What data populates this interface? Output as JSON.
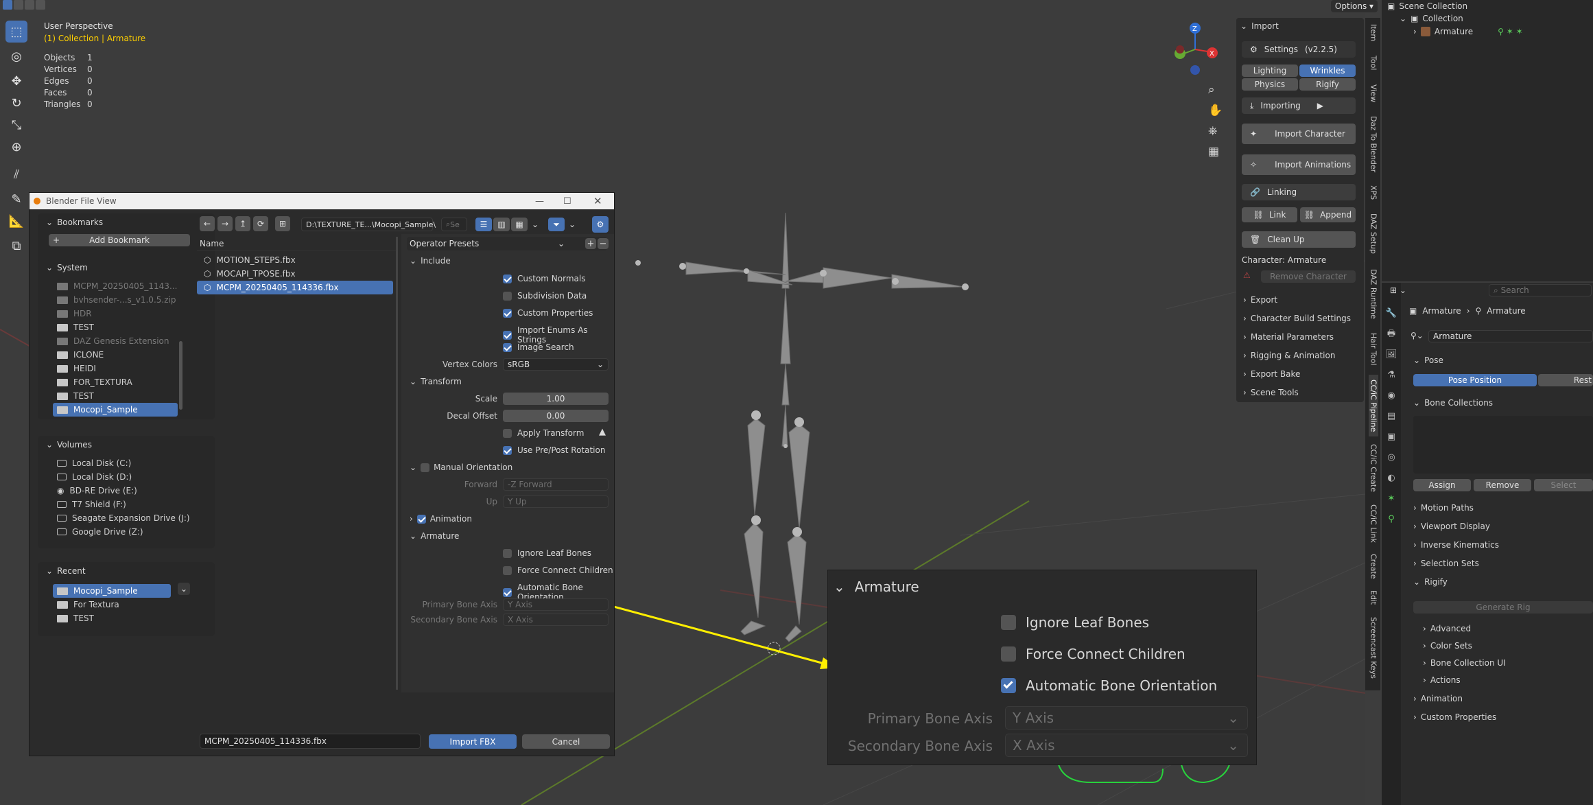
{
  "viewport": {
    "view_name": "User Perspective",
    "collection_label": "(1) Collection | Armature",
    "stats": [
      {
        "k": "Objects",
        "v": "1"
      },
      {
        "k": "Vertices",
        "v": "0"
      },
      {
        "k": "Edges",
        "v": "0"
      },
      {
        "k": "Faces",
        "v": "0"
      },
      {
        "k": "Triangles",
        "v": "0"
      }
    ],
    "options_label": "Options",
    "gizmo_z": "Z",
    "gizmo_x": "X"
  },
  "colors": {
    "accent": "#4772b3",
    "selection": "#4772b3",
    "arrow": "#ffef00",
    "label_yellow": "#ffd000"
  },
  "file_view": {
    "title": "Blender File View",
    "path": "D:\\TEXTURE_TE...\\Mocopi_Sample\\",
    "search_placeholder": "Se",
    "column_name": "Name",
    "files": [
      "MOTION_STEPS.fbx",
      "MOCAPI_TPOSE.fbx",
      "MCPM_20250405_114336.fbx"
    ],
    "filename_value": "MCPM_20250405_114336.fbx",
    "import_label": "Import FBX",
    "cancel_label": "Cancel",
    "bookmarks": {
      "title": "Bookmarks",
      "add_label": "Add Bookmark"
    },
    "system": {
      "title": "System",
      "items": [
        "MCPM_20250405_1143...",
        "bvhsender-...s_v1.0.5.zip",
        "HDR",
        "TEST",
        "DAZ Genesis Extension",
        "ICLONE",
        "HEIDI",
        "FOR_TEXTURA",
        "TEST",
        "Mocopi_Sample"
      ]
    },
    "volumes": {
      "title": "Volumes",
      "items": [
        "Local Disk (C:)",
        "Local Disk (D:)",
        "BD-RE Drive (E:)",
        "T7 Shield (F:)",
        "Seagate Expansion Drive (J:)",
        "Google Drive (Z:)"
      ]
    },
    "recent": {
      "title": "Recent",
      "items": [
        "Mocopi_Sample",
        "For Textura",
        "TEST"
      ]
    }
  },
  "operator": {
    "presets_label": "Operator Presets",
    "include": {
      "title": "Include",
      "custom_normals": "Custom Normals",
      "subdivision_data": "Subdivision Data",
      "custom_properties": "Custom Properties",
      "import_enums": "Import Enums As Strings",
      "image_search": "Image Search",
      "vertex_colors_label": "Vertex Colors",
      "vertex_colors_value": "sRGB"
    },
    "transform": {
      "title": "Transform",
      "scale_label": "Scale",
      "scale_value": "1.00",
      "decal_label": "Decal Offset",
      "decal_value": "0.00",
      "apply_transform": "Apply Transform",
      "use_pre_post": "Use Pre/Post Rotation"
    },
    "manual_orientation": {
      "title": "Manual Orientation",
      "forward_label": "Forward",
      "forward_value": "-Z Forward",
      "up_label": "Up",
      "up_value": "Y Up"
    },
    "animation": {
      "title": "Animation"
    },
    "armature": {
      "title": "Armature",
      "ignore_leaf": "Ignore Leaf Bones",
      "force_connect": "Force Connect Children",
      "auto_orient": "Automatic Bone Orientation",
      "primary_label": "Primary Bone Axis",
      "primary_value": "Y Axis",
      "secondary_label": "Secondary Bone Axis",
      "secondary_value": "X Axis"
    }
  },
  "zoom_panel": {
    "title": "Armature",
    "ignore_leaf": "Ignore Leaf Bones",
    "force_connect": "Force Connect Children",
    "auto_orient": "Automatic Bone Orientation",
    "primary_label": "Primary Bone Axis",
    "primary_value": "Y Axis",
    "secondary_label": "Secondary Bone Axis",
    "secondary_value": "X Axis"
  },
  "npanel": {
    "import_title": "Import",
    "settings_label": "Settings",
    "version": "(v2.2.5)",
    "tabs": [
      "Lighting",
      "Wrinkles",
      "Physics",
      "Rigify"
    ],
    "importing": "Importing",
    "import_character": "Import Character",
    "import_animations": "Import Animations",
    "linking": "Linking",
    "link": "Link",
    "append": "Append",
    "clean_up": "Clean Up",
    "character_label": "Character: Armature",
    "remove_character": "Remove Character",
    "sections": [
      "Export",
      "Character Build Settings",
      "Material Parameters",
      "Rigging & Animation",
      "Export Bake",
      "Scene Tools"
    ],
    "vertical_tabs": [
      "Item",
      "Tool",
      "View",
      "Daz To Blender",
      "XPS",
      "DAZ Setup",
      "DAZ Runtime",
      "Hair Tool",
      "CC/iC Pipeline",
      "CC/iC Create",
      "CC/iC Link",
      "Create",
      "Edit",
      "Screencast Keys"
    ]
  },
  "outliner": {
    "scene_collection": "Scene Collection",
    "collection": "Collection",
    "armature": "Armature"
  },
  "properties": {
    "search_placeholder": "Search",
    "breadcrumb_a": "Armature",
    "breadcrumb_b": "Armature",
    "data_name": "Armature",
    "pose_title": "Pose",
    "pose_position": "Pose Position",
    "rest_position": "Rest",
    "bone_collections": "Bone Collections",
    "assign": "Assign",
    "remove": "Remove",
    "select": "Select",
    "sections": [
      "Motion Paths",
      "Viewport Display",
      "Inverse Kinematics",
      "Selection Sets"
    ],
    "rigify_title": "Rigify",
    "generate_rig": "Generate Rig",
    "rigify_sub": [
      "Advanced",
      "Color Sets",
      "Bone Collection UI",
      "Actions"
    ],
    "animation": "Animation",
    "custom_properties": "Custom Properties"
  }
}
